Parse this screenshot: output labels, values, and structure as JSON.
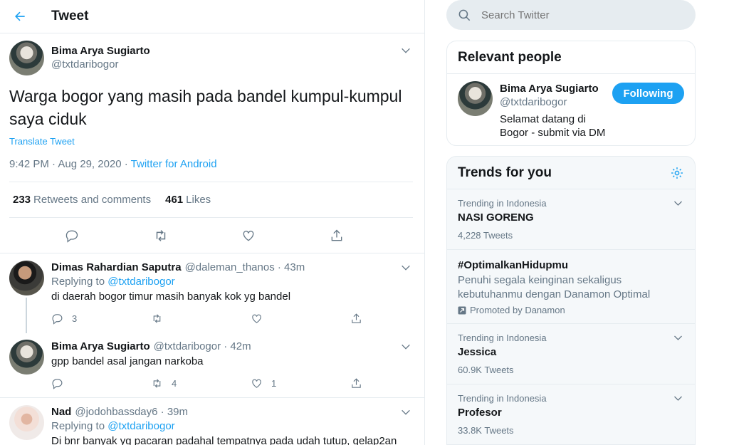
{
  "header": {
    "title": "Tweet"
  },
  "main_tweet": {
    "author_name": "Bima Arya Sugiarto",
    "author_handle": "@txtdaribogor",
    "text": "Warga bogor yang masih pada bandel kumpul-kumpul saya ciduk",
    "translate": "Translate Tweet",
    "time": "9:42 PM · Aug 29, 2020 · ",
    "source": "Twitter for Android",
    "retweets_count": "233",
    "retweets_label": "Retweets and comments",
    "likes_count": "461",
    "likes_label": "Likes"
  },
  "replies": [
    {
      "name": "Dimas Rahardian Saputra",
      "handle": "@daleman_thanos · 43m",
      "replying_prefix": "Replying to ",
      "replying_to": "@txtdaribogor",
      "text": "di daerah bogor timur masih banyak kok yg bandel",
      "reply_count": "3",
      "retweet_count": "",
      "like_count": ""
    },
    {
      "name": "Bima Arya Sugiarto",
      "handle": "@txtdaribogor · 42m",
      "text": "gpp bandel asal jangan narkoba",
      "reply_count": "",
      "retweet_count": "4",
      "like_count": "1"
    },
    {
      "name": "Nad",
      "handle": "@jodohbassday6 · 39m",
      "replying_prefix": "Replying to ",
      "replying_to": "@txtdaribogor",
      "text": "Di bnr banyak yg pacaran padahal tempatnya pada udah tutup, gelap2an"
    }
  ],
  "search": {
    "placeholder": "Search Twitter"
  },
  "relevant_people": {
    "title": "Relevant people",
    "name": "Bima Arya Sugiarto",
    "handle": "@txtdaribogor",
    "follow_label": "Following",
    "bio": "Selamat datang di Bogor - submit via DM"
  },
  "trends": {
    "title": "Trends for you",
    "items": [
      {
        "context": "Trending in Indonesia",
        "name": "NASI GORENG",
        "count": "4,228 Tweets"
      },
      {
        "name": "#OptimalkanHidupmu",
        "desc": "Penuhi segala keinginan sekaligus kebutuhanmu dengan Danamon Optimal",
        "promo": "Promoted by Danamon"
      },
      {
        "context": "Trending in Indonesia",
        "name": "Jessica",
        "count": "60.9K Tweets"
      },
      {
        "context": "Trending in Indonesia",
        "name": "Profesor",
        "count": "33.8K Tweets"
      }
    ]
  },
  "colors": {
    "accent": "#1da1f2",
    "muted": "#657786",
    "border": "#e6ecf0"
  },
  "icons": [
    "back-arrow-icon",
    "chevron-down-icon",
    "reply-icon",
    "retweet-icon",
    "like-icon",
    "share-icon",
    "search-icon",
    "gear-icon",
    "promoted-icon"
  ]
}
